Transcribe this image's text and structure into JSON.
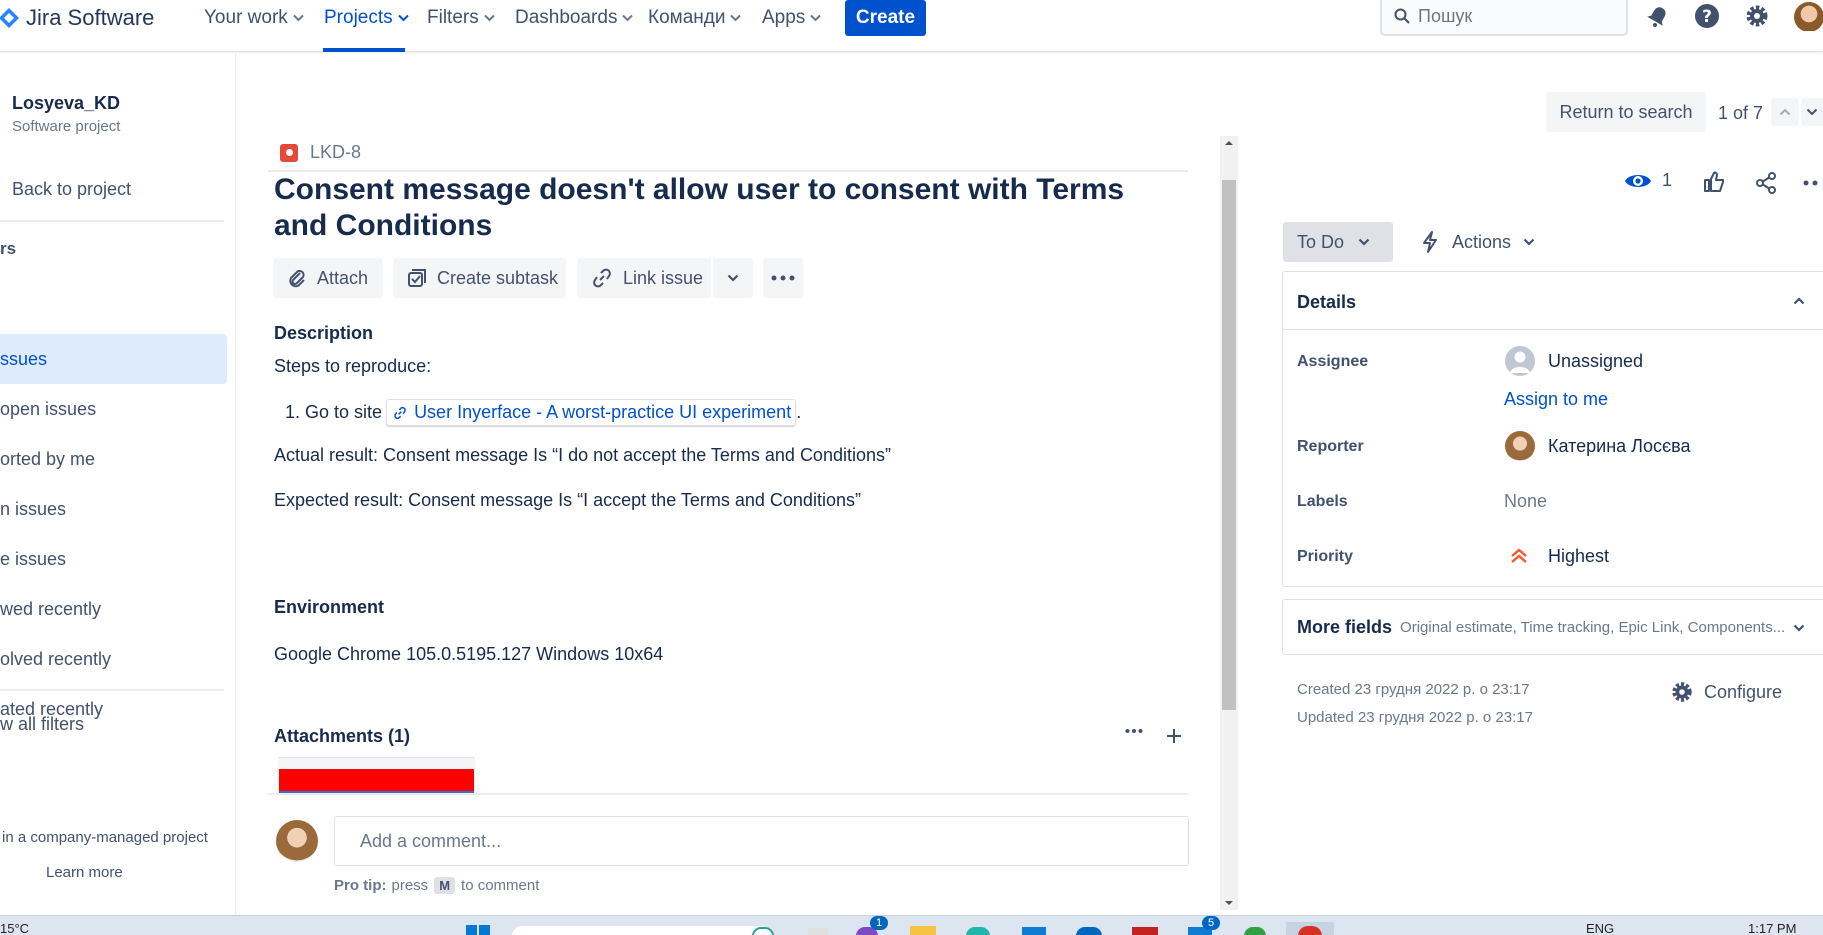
{
  "nav": {
    "logo_text": "Jira Software",
    "items": [
      "Your work",
      "Projects",
      "Filters",
      "Dashboards",
      "Команди",
      "Apps"
    ],
    "create_label": "Create",
    "search_placeholder": "Пошук"
  },
  "sidebar": {
    "project_name": "Losyeva_KD",
    "project_type": "Software project",
    "back_label": "Back to project",
    "section_label": "rs",
    "filters": [
      "ssues",
      "open issues",
      "orted by me",
      "n issues",
      "e issues",
      "wed recently",
      "olved recently",
      "ated recently"
    ],
    "view_all": "w all filters",
    "footer_text": "in a company-managed project",
    "learn_more": "Learn more"
  },
  "issue": {
    "key": "LKD-8",
    "title": "Consent message doesn't allow user to consent with Terms and Conditions",
    "actions": {
      "attach": "Attach",
      "create_subtask": "Create subtask",
      "link_issue": "Link issue"
    },
    "description_heading": "Description",
    "steps_heading": "Steps to reproduce:",
    "step1_prefix": "1. Go to site",
    "step1_link": "User Inyerface - A worst-practice UI experiment",
    "step1_suffix": ".",
    "actual_result": "Actual result: Consent message Is “I do not accept the Terms and Conditions”",
    "expected_result": "Expected result: Consent message Is “I accept the Terms and Conditions”",
    "environment_heading": "Environment",
    "environment_value": "Google Chrome 105.0.5195.127 Windows 10x64",
    "attachments_heading": "Attachments (1)",
    "comment_placeholder": "Add a comment...",
    "pro_tip_label": "Pro tip:",
    "pro_tip_press": "press",
    "pro_tip_key": "M",
    "pro_tip_suffix": "to comment"
  },
  "right": {
    "return_to_search": "Return to search",
    "pager": "1 of 7",
    "watchers_count": "1",
    "status": "To Do",
    "actions_label": "Actions",
    "details_heading": "Details",
    "assignee_label": "Assignee",
    "assignee_value": "Unassigned",
    "assign_to_me": "Assign to me",
    "reporter_label": "Reporter",
    "reporter_value": "Катерина Лосєва",
    "labels_label": "Labels",
    "labels_value": "None",
    "priority_label": "Priority",
    "priority_value": "Highest",
    "more_fields_label": "More fields",
    "more_fields_hint": "Original estimate, Time tracking, Epic Link, Components...",
    "created": "Created 23 грудня 2022 р. о 23:17",
    "updated": "Updated 23 грудня 2022 р. о 23:17",
    "configure": "Configure"
  },
  "taskbar": {
    "temperature": "15°C",
    "language": "ENG",
    "time": "1:17 PM",
    "badges": [
      "1",
      "5"
    ]
  },
  "colors": {
    "brand_blue": "#0052cc",
    "bug_red": "#e5493a",
    "priority_orange": "#ff5630",
    "selected_bg": "#deebff"
  }
}
